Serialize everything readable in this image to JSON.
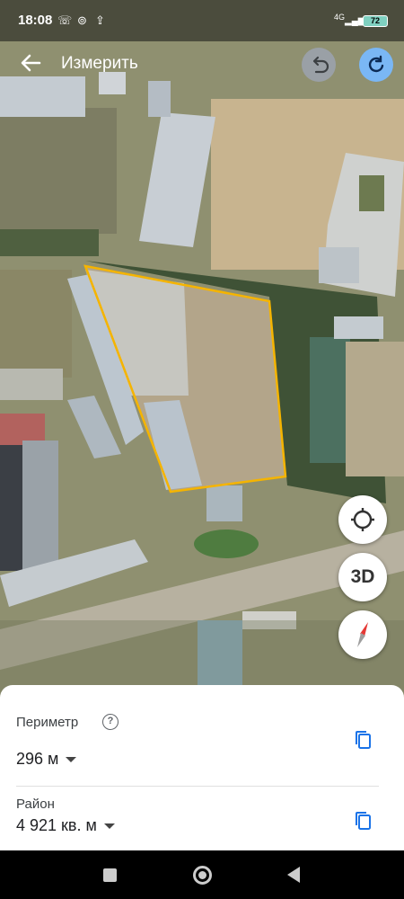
{
  "status_bar": {
    "time": "18:08",
    "network": "4G",
    "battery": "72"
  },
  "app_bar": {
    "title": "Измерить"
  },
  "map_controls": {
    "threed_label": "3D"
  },
  "measurements": {
    "perimeter_label": "Периметр",
    "perimeter_value": "296 м",
    "area_label": "Район",
    "area_value": "4 921 кв. м"
  },
  "colors": {
    "outline": "#f5b400",
    "redo_button": "#7ab7f5",
    "compass_red": "#e53935"
  }
}
